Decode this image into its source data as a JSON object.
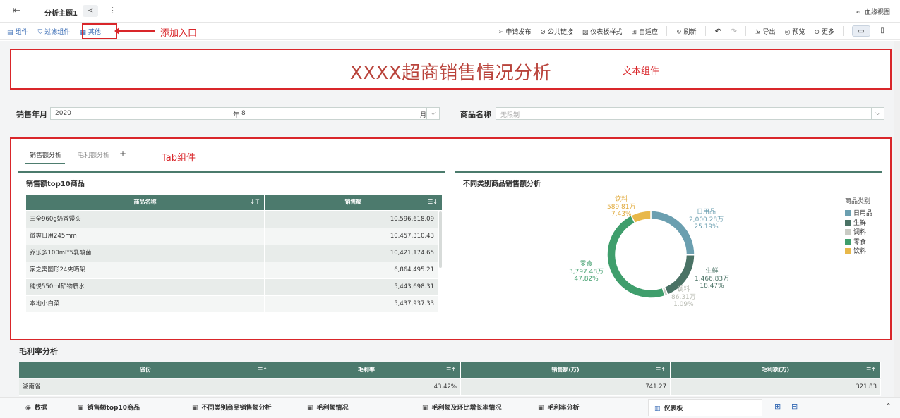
{
  "topbar": {
    "title": "分析主题1",
    "lineage": "血缘视图"
  },
  "toolbar": {
    "left": [
      {
        "label": "组件",
        "icon": "component-icon"
      },
      {
        "label": "过滤组件",
        "icon": "filter-component-icon"
      },
      {
        "label": "其他",
        "icon": "other-icon"
      }
    ],
    "right": [
      {
        "label": "申请发布",
        "icon": "send-icon"
      },
      {
        "label": "公共链接",
        "icon": "link-icon"
      },
      {
        "label": "仪表板样式",
        "icon": "style-icon"
      },
      {
        "label": "自适应",
        "icon": "fit-icon"
      },
      {
        "label": "刷新",
        "icon": "refresh-icon"
      },
      {
        "label": "导出",
        "icon": "export-icon"
      },
      {
        "label": "预览",
        "icon": "preview-icon"
      },
      {
        "label": "更多",
        "icon": "more-icon"
      }
    ]
  },
  "annotations": {
    "add_entry": "添加入口",
    "text_component": "文本组件",
    "tab_component": "Tab组件"
  },
  "dashboard": {
    "title": "XXXX超商销售情况分析",
    "filters": {
      "year_month_label": "销售年月",
      "year": "2020",
      "year_unit": "年",
      "month": "8",
      "month_unit": "月",
      "product_label": "商品名称",
      "product_placeholder": "无限制"
    },
    "tabs": [
      "销售额分析",
      "毛利额分析"
    ],
    "add_tab": "+",
    "top10": {
      "title": "销售额top10商品",
      "columns": [
        "商品名称",
        "销售额"
      ],
      "rows": [
        [
          "三全960g奶香馒头",
          "10,596,618.09"
        ],
        [
          "微爽日用245mm",
          "10,457,310.43"
        ],
        [
          "养乐多100ml*5乳酸菌",
          "10,421,174.65"
        ],
        [
          "家之寓圆形24夹晒架",
          "6,864,495.21"
        ],
        [
          "纯悦550ml矿物质水",
          "5,443,698.31"
        ],
        [
          "本地小白菜",
          "5,437,937.33"
        ]
      ]
    },
    "category_chart_title": "不同类别商品销售额分析",
    "margin": {
      "title": "毛利率分析",
      "columns": [
        "省份",
        "毛利率",
        "销售额(万)",
        "毛利额(万)"
      ],
      "rows": [
        [
          "湖南省",
          "43.42%",
          "741.27",
          "321.83"
        ]
      ]
    }
  },
  "chart_data": {
    "type": "pie",
    "legend_title": "商品类别",
    "legend_position": "right",
    "slices": [
      {
        "name": "日用品",
        "value": 2000.28,
        "label": "2,000.28万",
        "percent": "25.19%",
        "color": "#6b9fb0"
      },
      {
        "name": "生鲜",
        "value": 1466.83,
        "label": "1,466.83万",
        "percent": "18.47%",
        "color": "#4a7265"
      },
      {
        "name": "调料",
        "value": 86.31,
        "label": "86.31万",
        "percent": "1.09%",
        "color": "#c9cbc4"
      },
      {
        "name": "零食",
        "value": 3797.48,
        "label": "3,797.48万",
        "percent": "47.82%",
        "color": "#3f9e6c"
      },
      {
        "name": "饮料",
        "value": 589.81,
        "label": "589.81万",
        "percent": "7.43%",
        "color": "#e8b84a"
      }
    ]
  },
  "bottom_tabs": [
    {
      "label": "数据",
      "icon": "database-icon"
    },
    {
      "label": "销售额top10商品",
      "icon": "table-icon"
    },
    {
      "label": "不同类别商品销售额分析",
      "icon": "table-icon"
    },
    {
      "label": "毛利额情况",
      "icon": "table-icon"
    },
    {
      "label": "毛利额及环比增长率情况",
      "icon": "table-icon"
    },
    {
      "label": "毛利率分析",
      "icon": "table-icon"
    },
    {
      "label": "仪表板",
      "icon": "dashboard-icon"
    }
  ]
}
